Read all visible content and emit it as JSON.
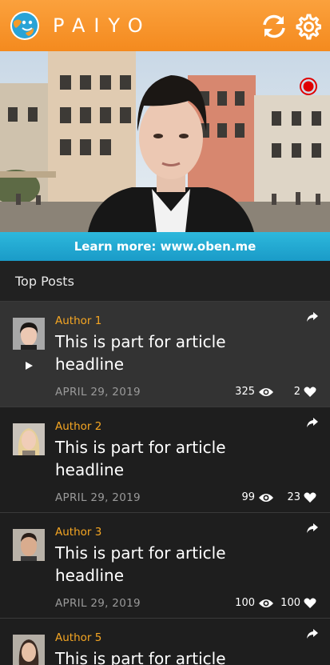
{
  "app": {
    "brand": "PAIYO",
    "accent": "#f5a623"
  },
  "banner": {
    "text": "Learn more: www.oben.me"
  },
  "section": {
    "title": "Top Posts"
  },
  "icons": {
    "logo": "globe-face-icon",
    "sync": "refresh-icon",
    "settings": "gear-icon",
    "record": "record-icon",
    "play": "play-icon",
    "share": "share-arrow-icon",
    "views": "eye-icon",
    "likes": "heart-icon"
  },
  "posts": [
    {
      "author": "Author 1",
      "headline": "This is part for article headline",
      "date": "APRIL 29, 2019",
      "views": "325",
      "likes": "2"
    },
    {
      "author": "Author 2",
      "headline": "This is part for article headline",
      "date": "APRIL 29, 2019",
      "views": "99",
      "likes": "23"
    },
    {
      "author": "Author 3",
      "headline": "This is part for article headline",
      "date": "APRIL 29, 2019",
      "views": "100",
      "likes": "100"
    },
    {
      "author": "Author 5",
      "headline": "This is part for article headline",
      "date": "",
      "views": "",
      "likes": ""
    }
  ]
}
